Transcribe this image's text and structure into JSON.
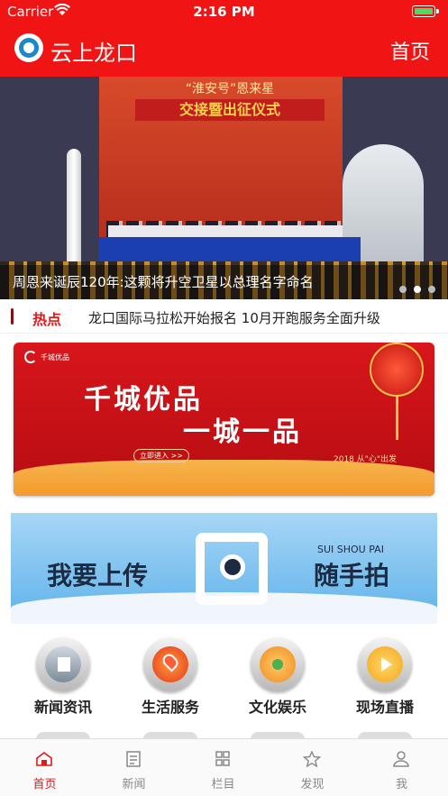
{
  "status_bar": {
    "carrier": "Carrier",
    "time": "2:16 PM",
    "battery_level": 1.0,
    "battery_color": "#4cd964"
  },
  "nav": {
    "title": "云上龙口",
    "home_link": "首页",
    "logo_icon": "app-logo-icon",
    "accent_color": "#f01414"
  },
  "hero": {
    "caption": "周恩来诞辰120年:这颗将升空卫星以总理名字命名",
    "image_banner_top": "“淮安号”恩来星",
    "image_banner_main": "交接暨出征仪式",
    "dots_count": 3,
    "active_dot": 2
  },
  "hot": {
    "label": "热点",
    "text": "龙口国际马拉松开始报名 10月开跑服务全面升级"
  },
  "ad1": {
    "brand_text": "千城优品",
    "line1": "千城优品",
    "line2": "一城一品",
    "cta": "立即进入 >>",
    "slogan": "2018 从\"心\"出发"
  },
  "ad2": {
    "left_text": "我要上传",
    "right_title": "SUI SHOU PAI",
    "right_text": "随手拍"
  },
  "features": [
    {
      "label": "新闻资讯",
      "icon": "news-icon"
    },
    {
      "label": "生活服务",
      "icon": "location-pin-icon"
    },
    {
      "label": "文化娱乐",
      "icon": "culture-icon"
    },
    {
      "label": "现场直播",
      "icon": "play-icon"
    }
  ],
  "tabs": [
    {
      "label": "首页",
      "icon": "home-icon",
      "active": true
    },
    {
      "label": "新闻",
      "icon": "news-list-icon",
      "active": false
    },
    {
      "label": "栏目",
      "icon": "grid-icon",
      "active": false
    },
    {
      "label": "发现",
      "icon": "discover-star-icon",
      "active": false
    },
    {
      "label": "我",
      "icon": "profile-icon",
      "active": false
    }
  ]
}
